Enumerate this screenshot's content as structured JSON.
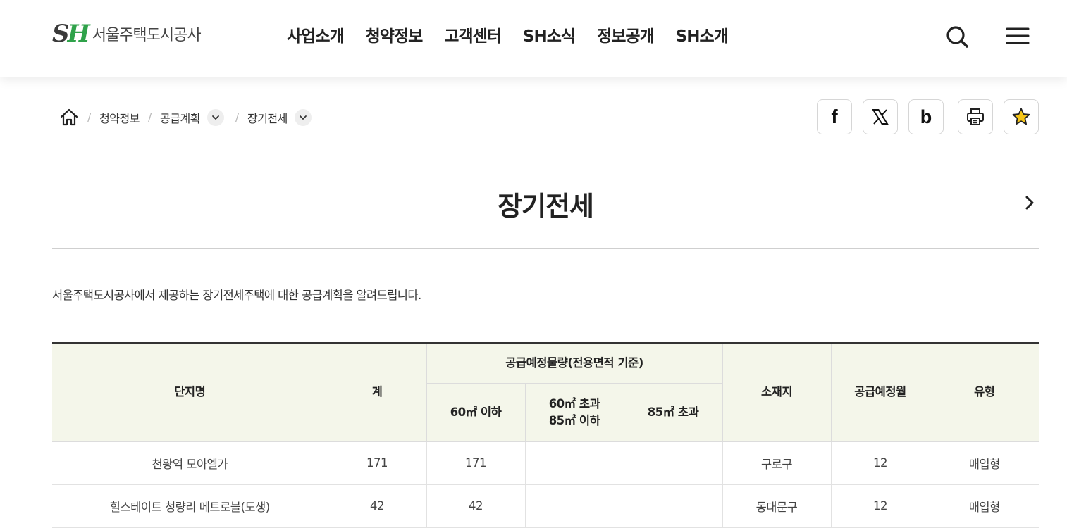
{
  "header": {
    "logo_mark_s": "S",
    "logo_mark_h": "H",
    "logo_text": "서울주택도시공사",
    "nav": [
      "사업소개",
      "청약정보",
      "고객센터",
      "SH소식",
      "정보공개",
      "SH소개"
    ],
    "search_icon": "search-icon",
    "menu_icon": "hamburger-menu-icon"
  },
  "breadcrumb": {
    "items": [
      "청약정보",
      "공급계획",
      "장기전세"
    ],
    "separator": "/"
  },
  "share": {
    "buttons": [
      "facebook-icon",
      "x-twitter-icon",
      "band-icon",
      "print-icon",
      "star-icon"
    ],
    "facebook_label": "f",
    "band_label": "b",
    "star_color": "#f5c518"
  },
  "page": {
    "title": "장기전세",
    "intro": "서울주택도시공사에서 제공하는 장기전세주택에 대한 공급계획을 알려드립니다."
  },
  "table": {
    "headers": {
      "name": "단지명",
      "total": "계",
      "supply_group": "공급예정물량(전용면적 기준)",
      "under60": "60㎡ 이하",
      "over60_line1": "60㎡ 초과",
      "over60_line2": "85㎡ 이하",
      "over85": "85㎡ 초과",
      "location": "소재지",
      "month": "공급예정월",
      "type": "유형"
    },
    "rows": [
      {
        "name": "천왕역 모아엘가",
        "total": "171",
        "under60": "171",
        "mid": "",
        "over85": "",
        "location": "구로구",
        "month": "12",
        "type": "매입형"
      },
      {
        "name": "힐스테이트 청량리 메트로블(도생)",
        "total": "42",
        "under60": "42",
        "mid": "",
        "over85": "",
        "location": "동대문구",
        "month": "12",
        "type": "매입형"
      }
    ]
  },
  "colors": {
    "brand_green": "#2fa24a",
    "table_header_bg": "#f4f6ea"
  }
}
